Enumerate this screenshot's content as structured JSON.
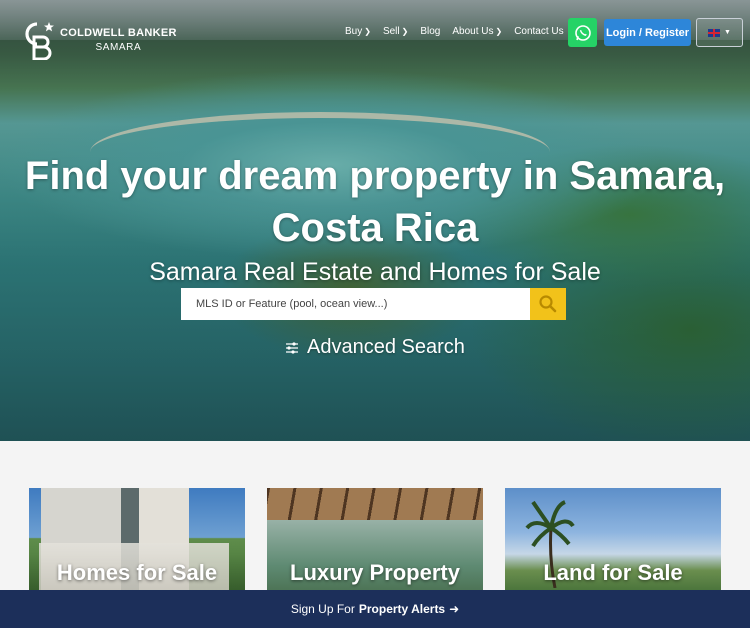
{
  "brand": {
    "name": "COLDWELL BANKER",
    "sub": "SAMARA"
  },
  "nav": {
    "items": [
      {
        "label": "Buy",
        "dropdown": true
      },
      {
        "label": "Sell",
        "dropdown": true
      },
      {
        "label": "Blog",
        "dropdown": false
      },
      {
        "label": "About Us",
        "dropdown": true
      },
      {
        "label": "Contact Us",
        "dropdown": false
      }
    ],
    "login_label": "Login / Register",
    "whatsapp_icon": "whatsapp-icon",
    "language_icon": "uk-flag-icon"
  },
  "hero": {
    "headline_line1": "Find your dream property in Samara,",
    "headline_line2": "Costa Rica",
    "subheadline": "Samara Real Estate and Homes for Sale",
    "search_placeholder": "MLS ID or Feature (pool, ocean view...)",
    "advanced_search": "Advanced Search"
  },
  "cards": [
    {
      "label": "Homes for Sale"
    },
    {
      "label": "Luxury Property"
    },
    {
      "label": "Land for Sale"
    }
  ],
  "alert_bar": {
    "prefix": "Sign Up For",
    "strong": "Property Alerts"
  },
  "colors": {
    "accent_blue": "#2d86d9",
    "search_yellow": "#f2c21a",
    "whatsapp_green": "#25d366",
    "navy_bar": "#1c2f5a"
  }
}
